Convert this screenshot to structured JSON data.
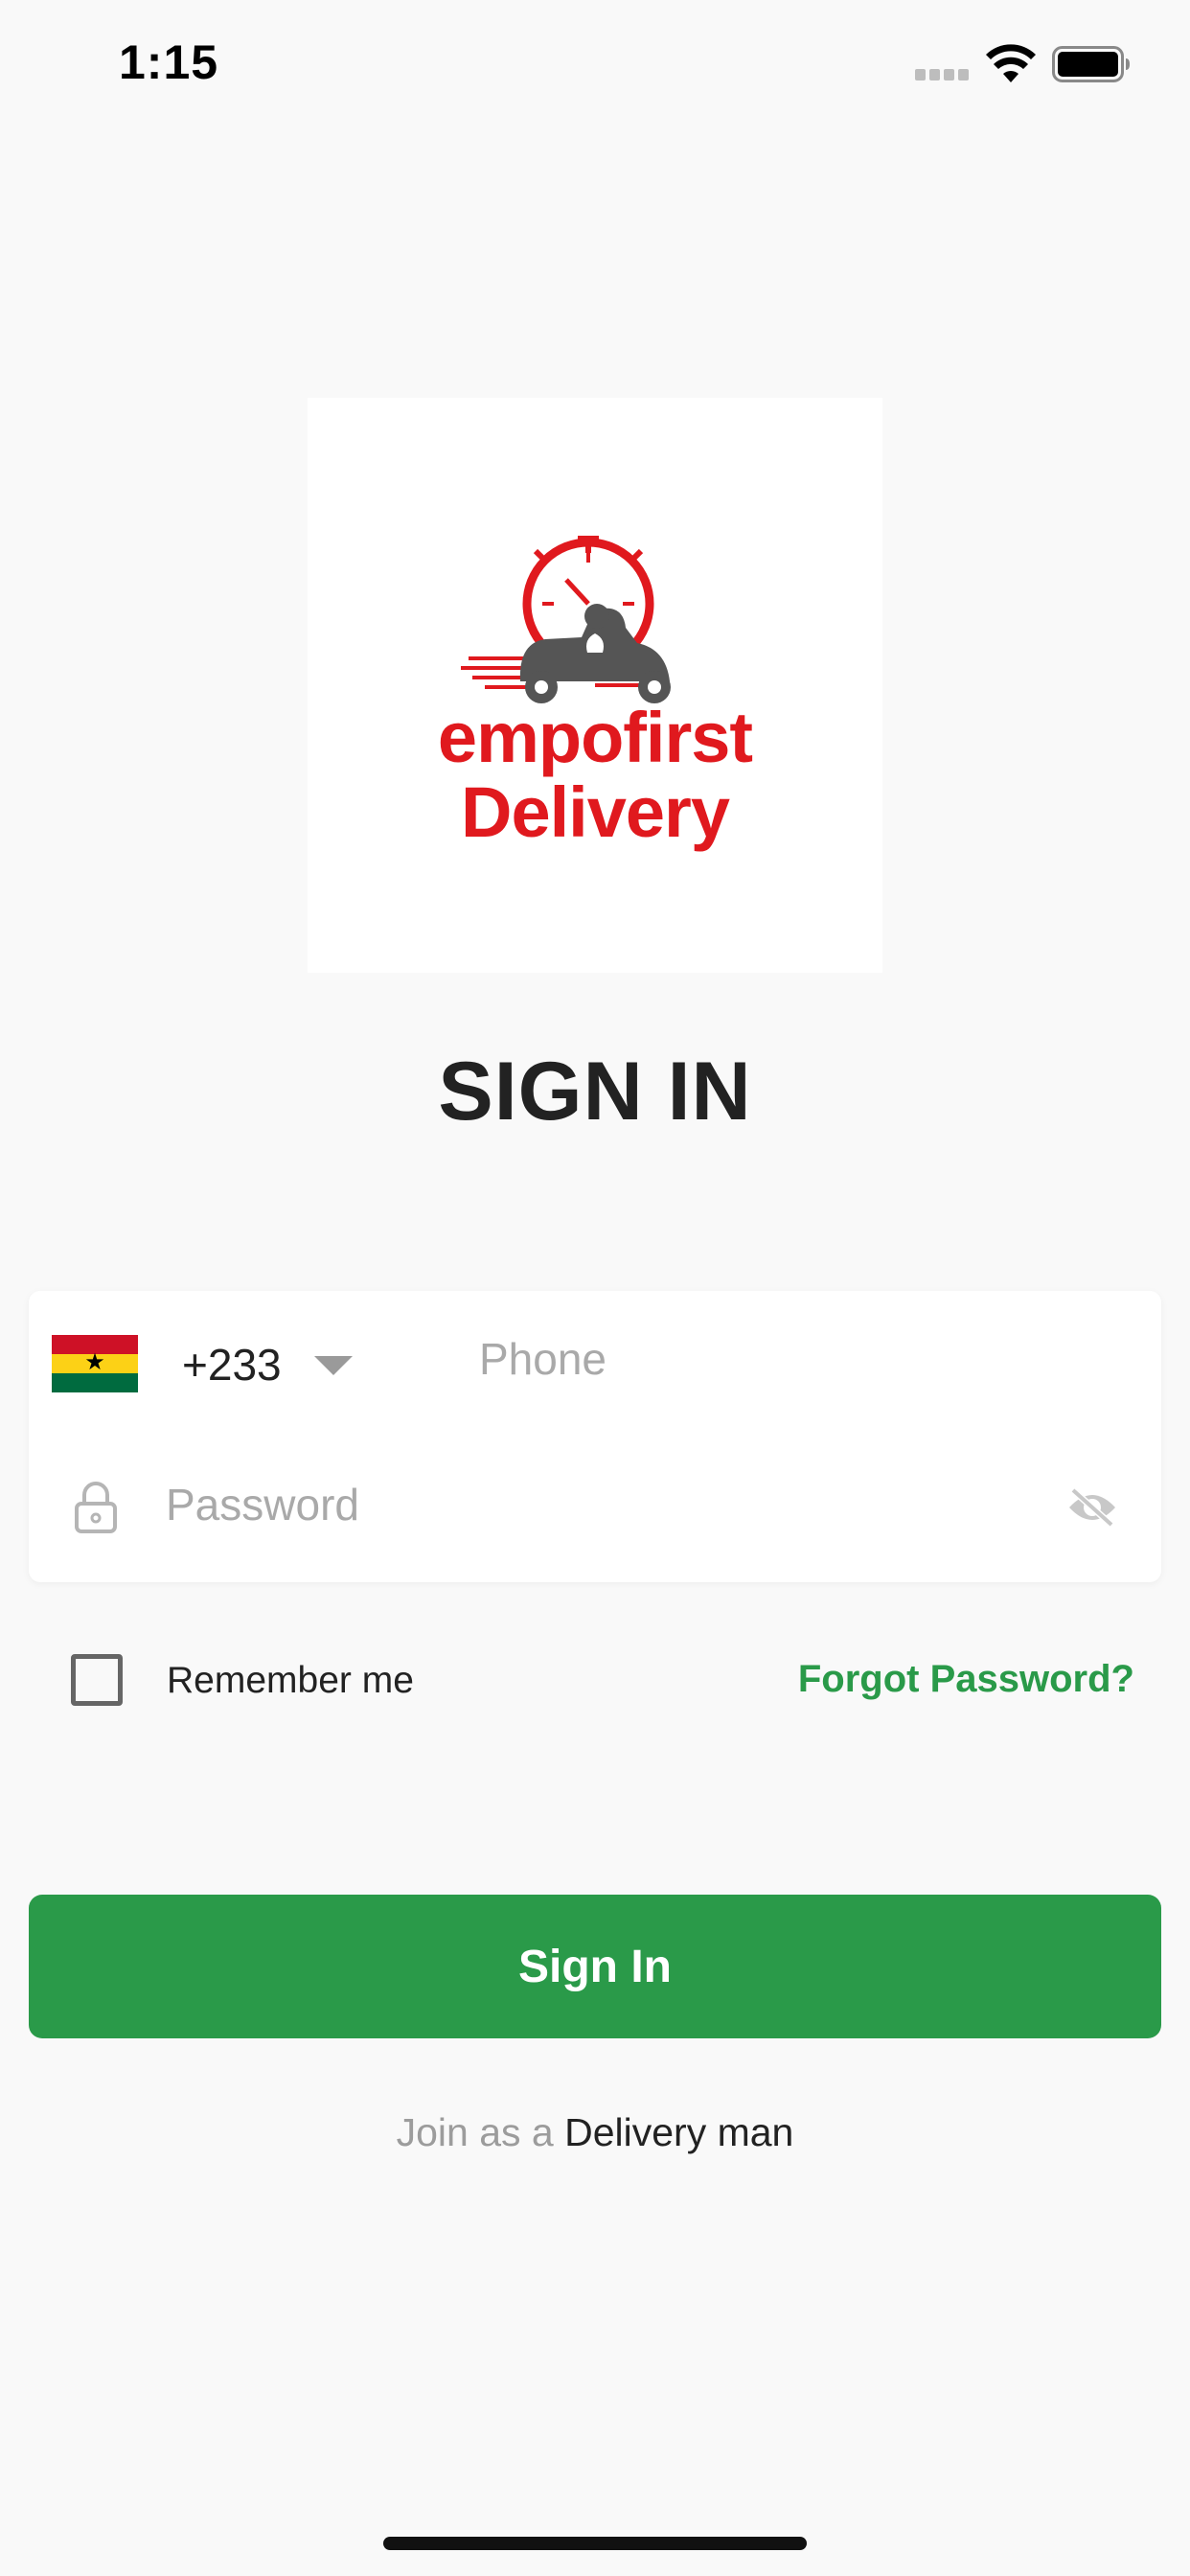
{
  "status_bar": {
    "time": "1:15"
  },
  "logo": {
    "line1": "empofirst",
    "line2": "Delivery",
    "brand_color": "#e0191e"
  },
  "page_title": "SIGN IN",
  "phone": {
    "country_code": "+233",
    "country_flag": "Ghana",
    "placeholder": "Phone",
    "value": ""
  },
  "password": {
    "placeholder": "Password",
    "value": ""
  },
  "remember": {
    "label": "Remember me",
    "checked": false
  },
  "forgot_label": "Forgot Password?",
  "signin_label": "Sign In",
  "join": {
    "prefix": "Join as a ",
    "link": "Delivery man"
  },
  "colors": {
    "accent": "#2a9a49",
    "background": "#f9f9f9",
    "flag_red": "#ce1126",
    "flag_yellow": "#fcd116",
    "flag_green": "#006b3f"
  }
}
